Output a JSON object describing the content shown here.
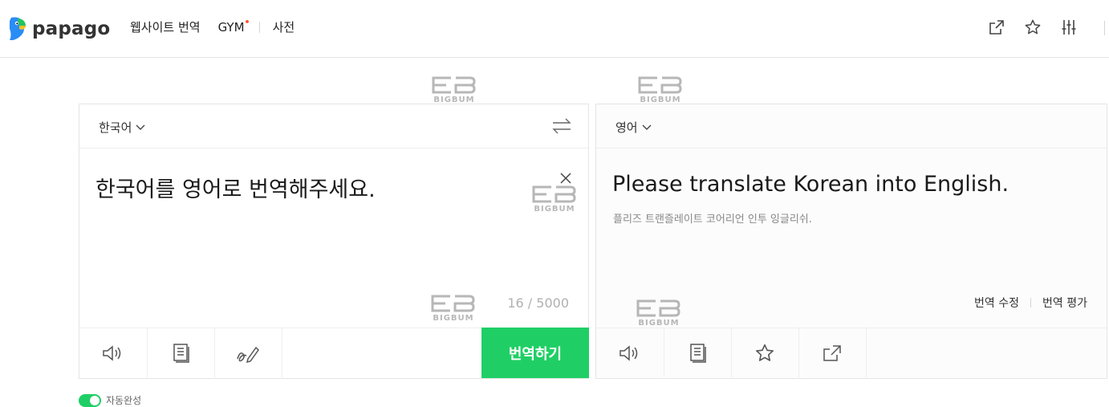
{
  "header": {
    "brand": "papago",
    "nav": {
      "website_translate": "웹사이트 번역",
      "gym": "GYM",
      "gym_badge": "•",
      "dictionary": "사전"
    },
    "icons": [
      "external-link-icon",
      "star-icon",
      "settings-sliders-icon"
    ]
  },
  "watermark": {
    "text": "BIGBUM"
  },
  "source": {
    "language": "한국어",
    "text": "한국어를 영어로 번역해주세요.",
    "char_count": "16 / 5000",
    "translate_button": "번역하기"
  },
  "target": {
    "language": "영어",
    "text": "Please translate Korean into English.",
    "pronunciation": "플리즈 트랜즐레이트 코어리언 인투 잉글리쉬.",
    "edit_label": "번역 수정",
    "rate_label": "번역 평가"
  },
  "auto_complete": {
    "label": "자동완성",
    "enabled": true
  },
  "colors": {
    "accent": "#1fcf65",
    "badge": "#ff4b2b",
    "logo_blue": "#2a8cf5",
    "logo_green": "#22c55e"
  }
}
